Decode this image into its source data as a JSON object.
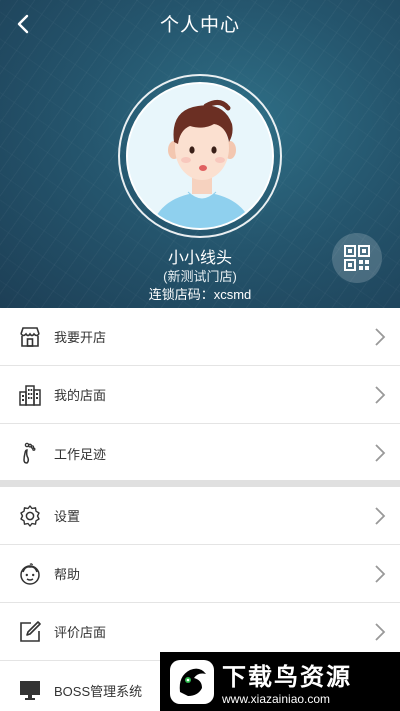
{
  "header": {
    "title": "个人中心",
    "user_name": "小小线头",
    "store_name": "(新测试门店)",
    "chain_code_label": "连锁店码：",
    "chain_code_value": "xcsmd"
  },
  "menu_group_1": [
    {
      "label": "我要开店",
      "icon": "storefront-icon"
    },
    {
      "label": "我的店面",
      "icon": "buildings-icon"
    },
    {
      "label": "工作足迹",
      "icon": "footprint-icon"
    }
  ],
  "menu_group_2": [
    {
      "label": "设置",
      "icon": "gear-icon"
    },
    {
      "label": "帮助",
      "icon": "help-face-icon"
    },
    {
      "label": "评价店面",
      "icon": "edit-icon"
    },
    {
      "label": "BOSS管理系统",
      "icon": "monitor-icon"
    }
  ],
  "watermark": {
    "brand": "下载鸟资源",
    "url": "www.xiazainiao.com"
  },
  "colors": {
    "header_bg": "#25566e",
    "accent": "#2f6f86",
    "watermark_bg": "#000000"
  }
}
